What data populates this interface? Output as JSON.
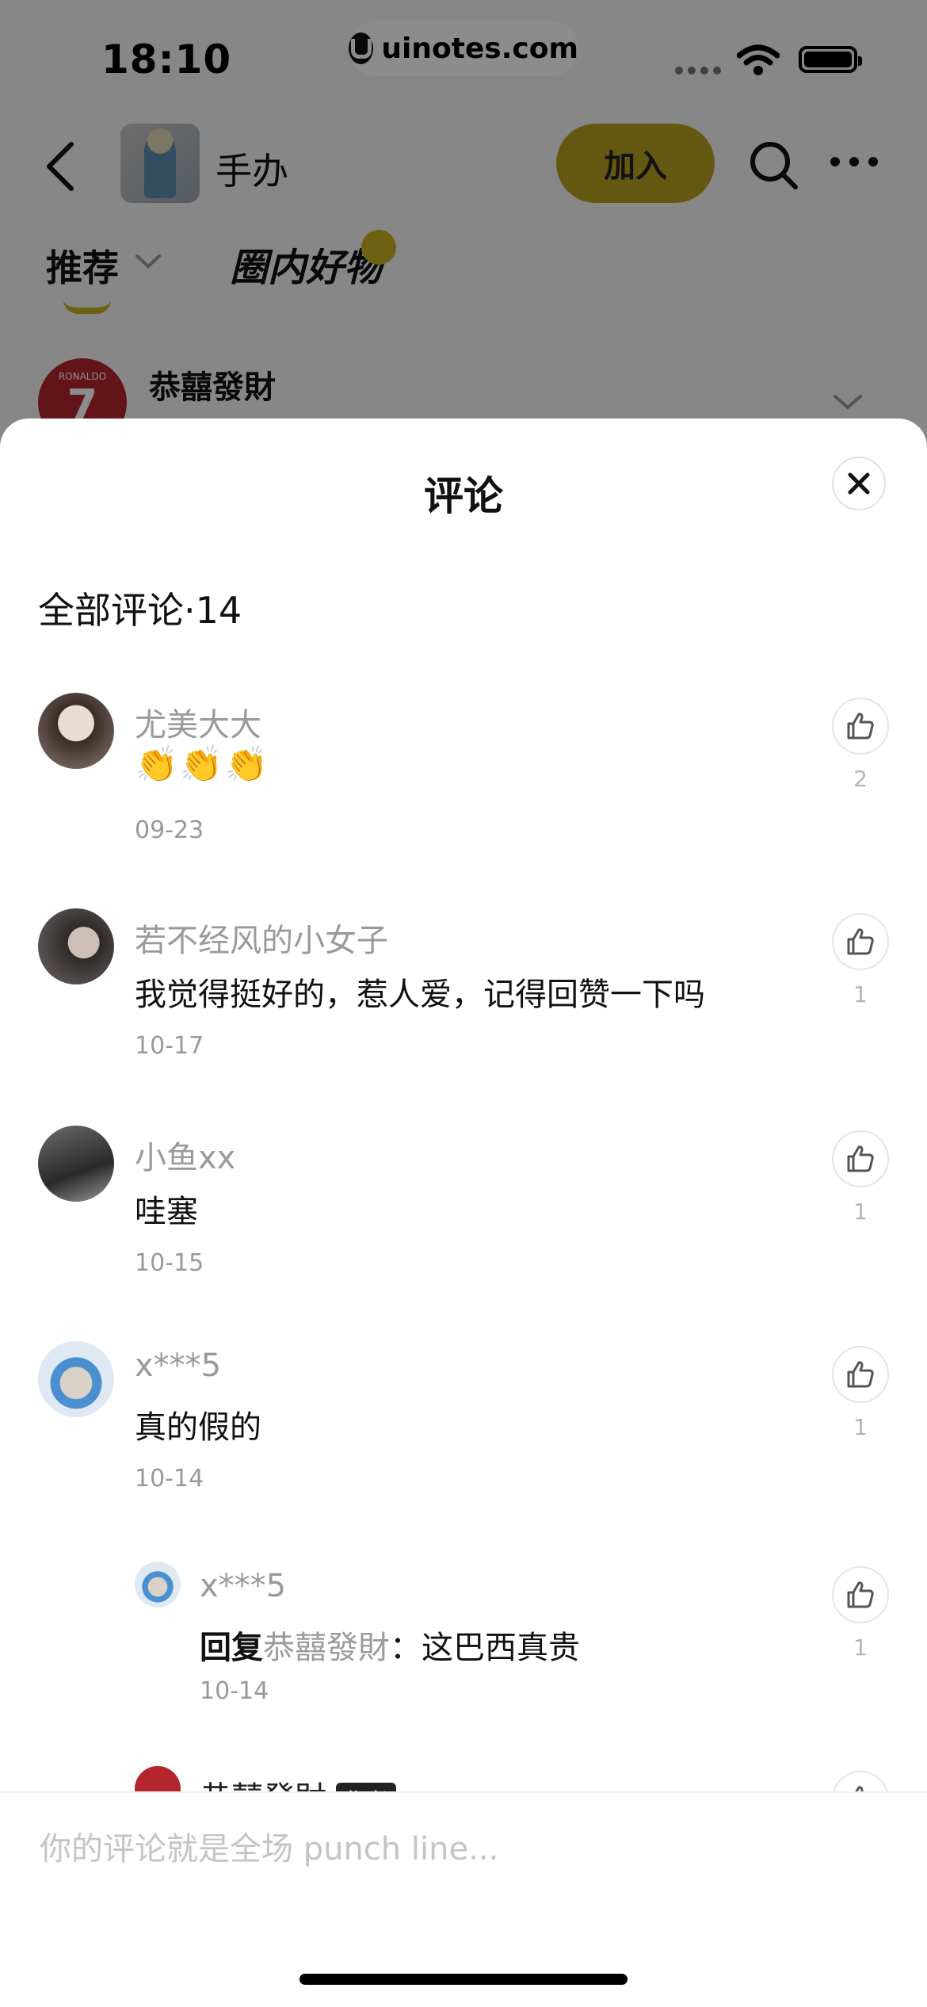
{
  "status_bar": {
    "time": "18:10",
    "url": "uinotes.com"
  },
  "header": {
    "group_name": "手办",
    "join_label": "加入"
  },
  "tabs": {
    "recommend": "推荐",
    "circle_goods": "圈内好物"
  },
  "post": {
    "author": "恭囍發財",
    "avatar_number": "7",
    "avatar_small": "RONALDO"
  },
  "sheet": {
    "title": "评论",
    "count_label": "全部评论·14"
  },
  "comments": [
    {
      "name": "尤美大大",
      "text": "👏👏👏",
      "date": "09-23",
      "likes": "2"
    },
    {
      "name": "若不经风的小女子",
      "text": "我觉得挺好的，惹人爱，记得回赞一下吗",
      "date": "10-17",
      "likes": "1"
    },
    {
      "name": "小鱼xx",
      "text": "哇塞",
      "date": "10-15",
      "likes": "1"
    },
    {
      "name": "x***5",
      "text": "真的假的",
      "date": "10-14",
      "likes": "1"
    }
  ],
  "replies": [
    {
      "name": "x***5",
      "reply_prefix": "回复",
      "reply_target": "恭囍發財",
      "reply_sep": "：",
      "text": "这巴西真贵",
      "date": "10-14",
      "likes": "1"
    },
    {
      "name": "恭囍發財",
      "badge": "作者"
    }
  ],
  "input": {
    "placeholder": "你的评论就是全场 punch line..."
  },
  "colors": {
    "accent_yellow": "#c5b223",
    "muted_text": "#9a9a9a",
    "author_badge": "#222222"
  }
}
